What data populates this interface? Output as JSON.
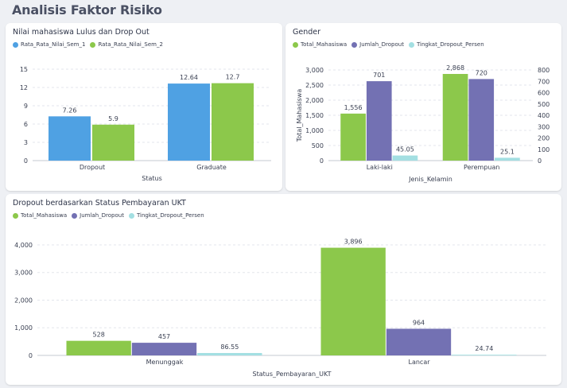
{
  "page": {
    "title": "Analisis Faktor Risiko"
  },
  "colors": {
    "blue": "#4fa1e3",
    "green": "#8cc84b",
    "purple": "#7371b3",
    "cyan": "#a3dfe2",
    "grid": "#e3e6ec"
  },
  "chart_data": [
    {
      "type": "bar",
      "title": "Nilai mahasiswa Lulus dan Drop Out",
      "xlabel": "Status",
      "ylabel": "",
      "categories": [
        "Dropout",
        "Graduate"
      ],
      "series": [
        {
          "name": "Rata_Rata_Nilai_Sem_1",
          "color": "#4fa1e3",
          "values": [
            7.26,
            12.64
          ],
          "labels": [
            "7.26",
            "12.64"
          ]
        },
        {
          "name": "Rata_Rata_Nilai_Sem_2",
          "color": "#8cc84b",
          "values": [
            5.9,
            12.7
          ],
          "labels": [
            "5.9",
            "12.7"
          ]
        }
      ],
      "ylim": [
        0,
        15
      ],
      "yticks": [
        0,
        3,
        6,
        9,
        12,
        15
      ],
      "ytick_labels": [
        "0",
        "3",
        "6",
        "9",
        "12",
        "15"
      ],
      "grid": true,
      "legend": "top-left"
    },
    {
      "type": "bar",
      "title": "Gender",
      "xlabel": "Jenis_Kelamin",
      "ylabel": "Total_Mahasiswa",
      "categories": [
        "Laki-laki",
        "Perempuan"
      ],
      "series": [
        {
          "name": "Total_Mahasiswa",
          "color": "#8cc84b",
          "axis": "left",
          "values": [
            1556,
            2868
          ],
          "labels": [
            "1,556",
            "2,868"
          ]
        },
        {
          "name": "Jumlah_Dropout",
          "color": "#7371b3",
          "axis": "right",
          "values": [
            701,
            720
          ],
          "labels": [
            "701",
            "720"
          ]
        },
        {
          "name": "Tingkat_Dropout_Persen",
          "color": "#a3dfe2",
          "axis": "right",
          "values": [
            45.05,
            25.1
          ],
          "labels": [
            "45.05",
            "25.1"
          ]
        }
      ],
      "ylim": [
        0,
        3000
      ],
      "yticks": [
        0,
        500,
        1000,
        1500,
        2000,
        2500,
        3000
      ],
      "ytick_labels": [
        "0",
        "500",
        "1,000",
        "1,500",
        "2,000",
        "2,500",
        "3,000"
      ],
      "y2lim": [
        0,
        800
      ],
      "y2ticks": [
        0,
        100,
        200,
        300,
        400,
        500,
        600,
        700,
        800
      ],
      "y2tick_labels": [
        "0",
        "100",
        "200",
        "300",
        "400",
        "500",
        "600",
        "700",
        "800"
      ],
      "grid": true,
      "legend": "top-left"
    },
    {
      "type": "bar",
      "title": "Dropout berdasarkan Status Pembayaran UKT",
      "xlabel": "Status_Pembayaran_UKT",
      "ylabel": "",
      "categories": [
        "Menunggak",
        "Lancar"
      ],
      "series": [
        {
          "name": "Total_Mahasiswa",
          "color": "#8cc84b",
          "values": [
            528,
            3896
          ],
          "labels": [
            "528",
            "3,896"
          ]
        },
        {
          "name": "Jumlah_Dropout",
          "color": "#7371b3",
          "values": [
            457,
            964
          ],
          "labels": [
            "457",
            "964"
          ]
        },
        {
          "name": "Tingkat_Dropout_Persen",
          "color": "#a3dfe2",
          "values": [
            86.55,
            24.74
          ],
          "labels": [
            "86.55",
            "24.74"
          ]
        }
      ],
      "ylim": [
        0,
        4200
      ],
      "yticks": [
        0,
        1000,
        2000,
        3000,
        4000
      ],
      "ytick_labels": [
        "0",
        "1,000",
        "2,000",
        "3,000",
        "4,000"
      ],
      "grid": true,
      "legend": "top-left"
    }
  ]
}
